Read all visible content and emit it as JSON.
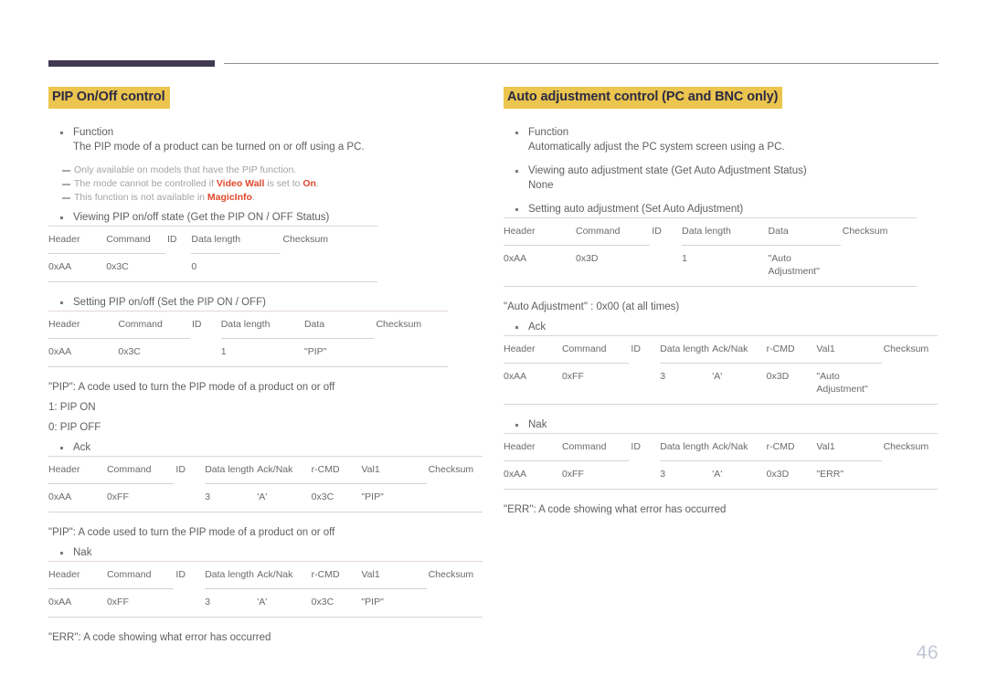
{
  "page_number": "46",
  "colors": {
    "heading_highlight": "#ebc54e",
    "heading_text": "#2c2a45",
    "top_bar": "#413a52",
    "note_emphasis": "#e2472b",
    "page_number": "#c3c7d4"
  },
  "left": {
    "heading": "PIP On/Off control",
    "function_label": "Function",
    "function_text": "The PIP mode of a product can be turned on or off using a PC.",
    "notes": [
      {
        "pre": "Only available on models that have the PIP function.",
        "mid": "",
        "em1": "",
        "em2": "",
        "post": ""
      },
      {
        "pre": "The mode cannot be controlled if ",
        "em1": "Video Wall",
        "mid": " is set to ",
        "em2": "On",
        "post": "."
      },
      {
        "pre": "This function is not available in ",
        "em1": "MagicInfo",
        "mid": "",
        "em2": "",
        "post": "."
      }
    ],
    "view_bullet": "Viewing PIP on/off state (Get the PIP ON / OFF Status)",
    "view_table": {
      "headers": [
        "Header",
        "Command",
        "ID",
        "Data length",
        "Checksum"
      ],
      "row": [
        "0xAA",
        "0x3C",
        "",
        "0",
        ""
      ]
    },
    "set_bullet": "Setting PIP on/off (Set the PIP ON / OFF)",
    "set_table": {
      "headers": [
        "Header",
        "Command",
        "ID",
        "Data length",
        "Data",
        "Checksum"
      ],
      "row": [
        "0xAA",
        "0x3C",
        "",
        "1",
        "\"PIP\"",
        ""
      ]
    },
    "pip_desc": "\"PIP\": A code used to turn the PIP mode of a product on or off",
    "pip_on": "1: PIP ON",
    "pip_off": "0: PIP OFF",
    "ack_bullet": "Ack",
    "ack_table": {
      "headers": [
        "Header",
        "Command",
        "ID",
        "Data length",
        "Ack/Nak",
        "r-CMD",
        "Val1",
        "Checksum"
      ],
      "row": [
        "0xAA",
        "0xFF",
        "",
        "3",
        "'A'",
        "0x3C",
        "\"PIP\"",
        ""
      ]
    },
    "ack_desc": "\"PIP\": A code used to turn the PIP mode of a product on or off",
    "nak_bullet": "Nak",
    "nak_table": {
      "headers": [
        "Header",
        "Command",
        "ID",
        "Data length",
        "Ack/Nak",
        "r-CMD",
        "Val1",
        "Checksum"
      ],
      "row": [
        "0xAA",
        "0xFF",
        "",
        "3",
        "'A'",
        "0x3C",
        "\"PIP\"",
        ""
      ]
    },
    "err_desc": "\"ERR\": A code showing what error has occurred"
  },
  "right": {
    "heading": "Auto adjustment control (PC and BNC only)",
    "function_label": "Function",
    "function_text": "Automatically adjust the PC system screen using a PC.",
    "view_bullet": "Viewing auto adjustment state (Get Auto Adjustment Status)",
    "view_value": "None",
    "set_bullet": "Setting auto adjustment (Set Auto Adjustment)",
    "set_table": {
      "headers": [
        "Header",
        "Command",
        "ID",
        "Data length",
        "Data",
        "Checksum"
      ],
      "row": [
        "0xAA",
        "0x3D",
        "",
        "1",
        "\"Auto Adjustment\"",
        ""
      ]
    },
    "auto_desc": "\"Auto Adjustment\" : 0x00 (at all times)",
    "ack_bullet": "Ack",
    "ack_table": {
      "headers": [
        "Header",
        "Command",
        "ID",
        "Data length",
        "Ack/Nak",
        "r-CMD",
        "Val1",
        "Checksum"
      ],
      "row": [
        "0xAA",
        "0xFF",
        "",
        "3",
        "'A'",
        "0x3D",
        "\"Auto Adjustment\"",
        ""
      ]
    },
    "nak_bullet": "Nak",
    "nak_table": {
      "headers": [
        "Header",
        "Command",
        "ID",
        "Data length",
        "Ack/Nak",
        "r-CMD",
        "Val1",
        "Checksum"
      ],
      "row": [
        "0xAA",
        "0xFF",
        "",
        "3",
        "'A'",
        "0x3D",
        "\"ERR\"",
        ""
      ]
    },
    "err_desc": "\"ERR\": A code showing what error has occurred"
  }
}
